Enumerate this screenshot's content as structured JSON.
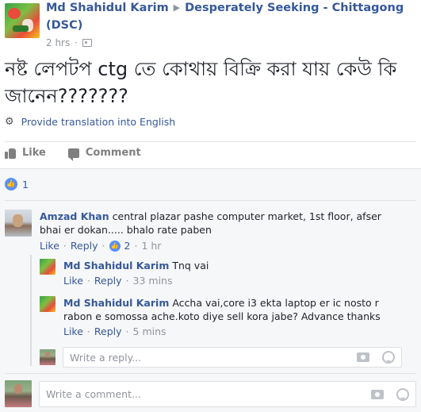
{
  "post": {
    "author": "Md Shahidul Karim",
    "group_line1": "Desperately Seeking - Chittagong",
    "group_line2": "(DSC)",
    "time": "2 hrs",
    "text": "নষ্ট লেপটপ ctg তে কোথায় বিক্রি করা যায় কেউ কি জানেন???????",
    "translate_label": "Provide translation into English"
  },
  "actions": {
    "like_label": "Like",
    "comment_label": "Comment"
  },
  "reactions": {
    "count": "1"
  },
  "comments": [
    {
      "author": "Amzad Khan",
      "text": "central plazar pashe computer market, 1st floor, afser bhai er dokan..... bhalo rate paben",
      "like_label": "Like",
      "reply_label": "Reply",
      "like_count": "2",
      "time": "1 hr"
    }
  ],
  "replies": [
    {
      "author": "Md Shahidul Karim",
      "text": "Tnq vai",
      "like_label": "Like",
      "reply_label": "Reply",
      "time": "33 mins"
    },
    {
      "author": "Md Shahidul Karim",
      "text": "Accha vai,core i3 ekta laptop er ic nosto r rabon e somossa ache.koto diye sell kora jabe? Advance thanks",
      "like_label": "Like",
      "reply_label": "Reply",
      "time": "5 mins"
    }
  ],
  "reply_input": {
    "placeholder": "Write a reply..."
  },
  "comment_input": {
    "placeholder": "Write a comment..."
  },
  "icons": {
    "separator": "▶",
    "dot": "·",
    "gear": "⚙",
    "thumb": "👍"
  },
  "colors": {
    "link": "#365899",
    "meta": "#90949c",
    "like_blue": "#5890ff"
  }
}
